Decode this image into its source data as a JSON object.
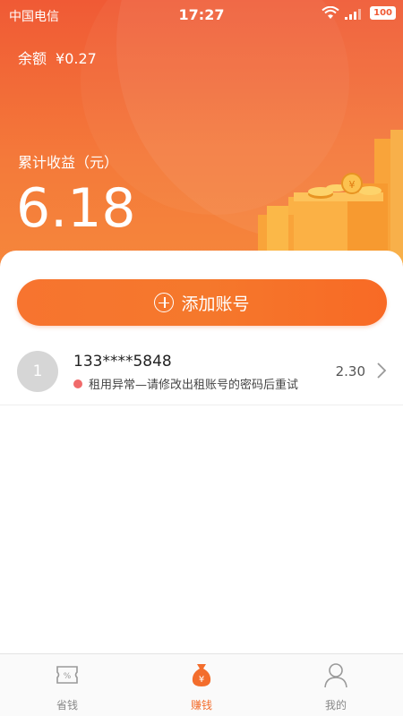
{
  "status_bar": {
    "carrier": "中国电信",
    "time": "17:27",
    "battery": "100"
  },
  "balance": {
    "label": "余额",
    "value": "¥0.27"
  },
  "earnings": {
    "label": "累计收益（元）",
    "value": "6.18"
  },
  "add_account": {
    "label": "添加账号"
  },
  "accounts": [
    {
      "index": "1",
      "number": "133****5848",
      "status": "租用异常—请修改出租账号的密码后重试",
      "amount": "2.30"
    }
  ],
  "tabs": [
    {
      "label": "省钱",
      "icon": "coupon-icon",
      "active": false
    },
    {
      "label": "赚钱",
      "icon": "money-bag-icon",
      "active": true
    },
    {
      "label": "我的",
      "icon": "person-icon",
      "active": false
    }
  ],
  "colors": {
    "accent": "#f36d2c",
    "status_error": "#f06a6a"
  }
}
